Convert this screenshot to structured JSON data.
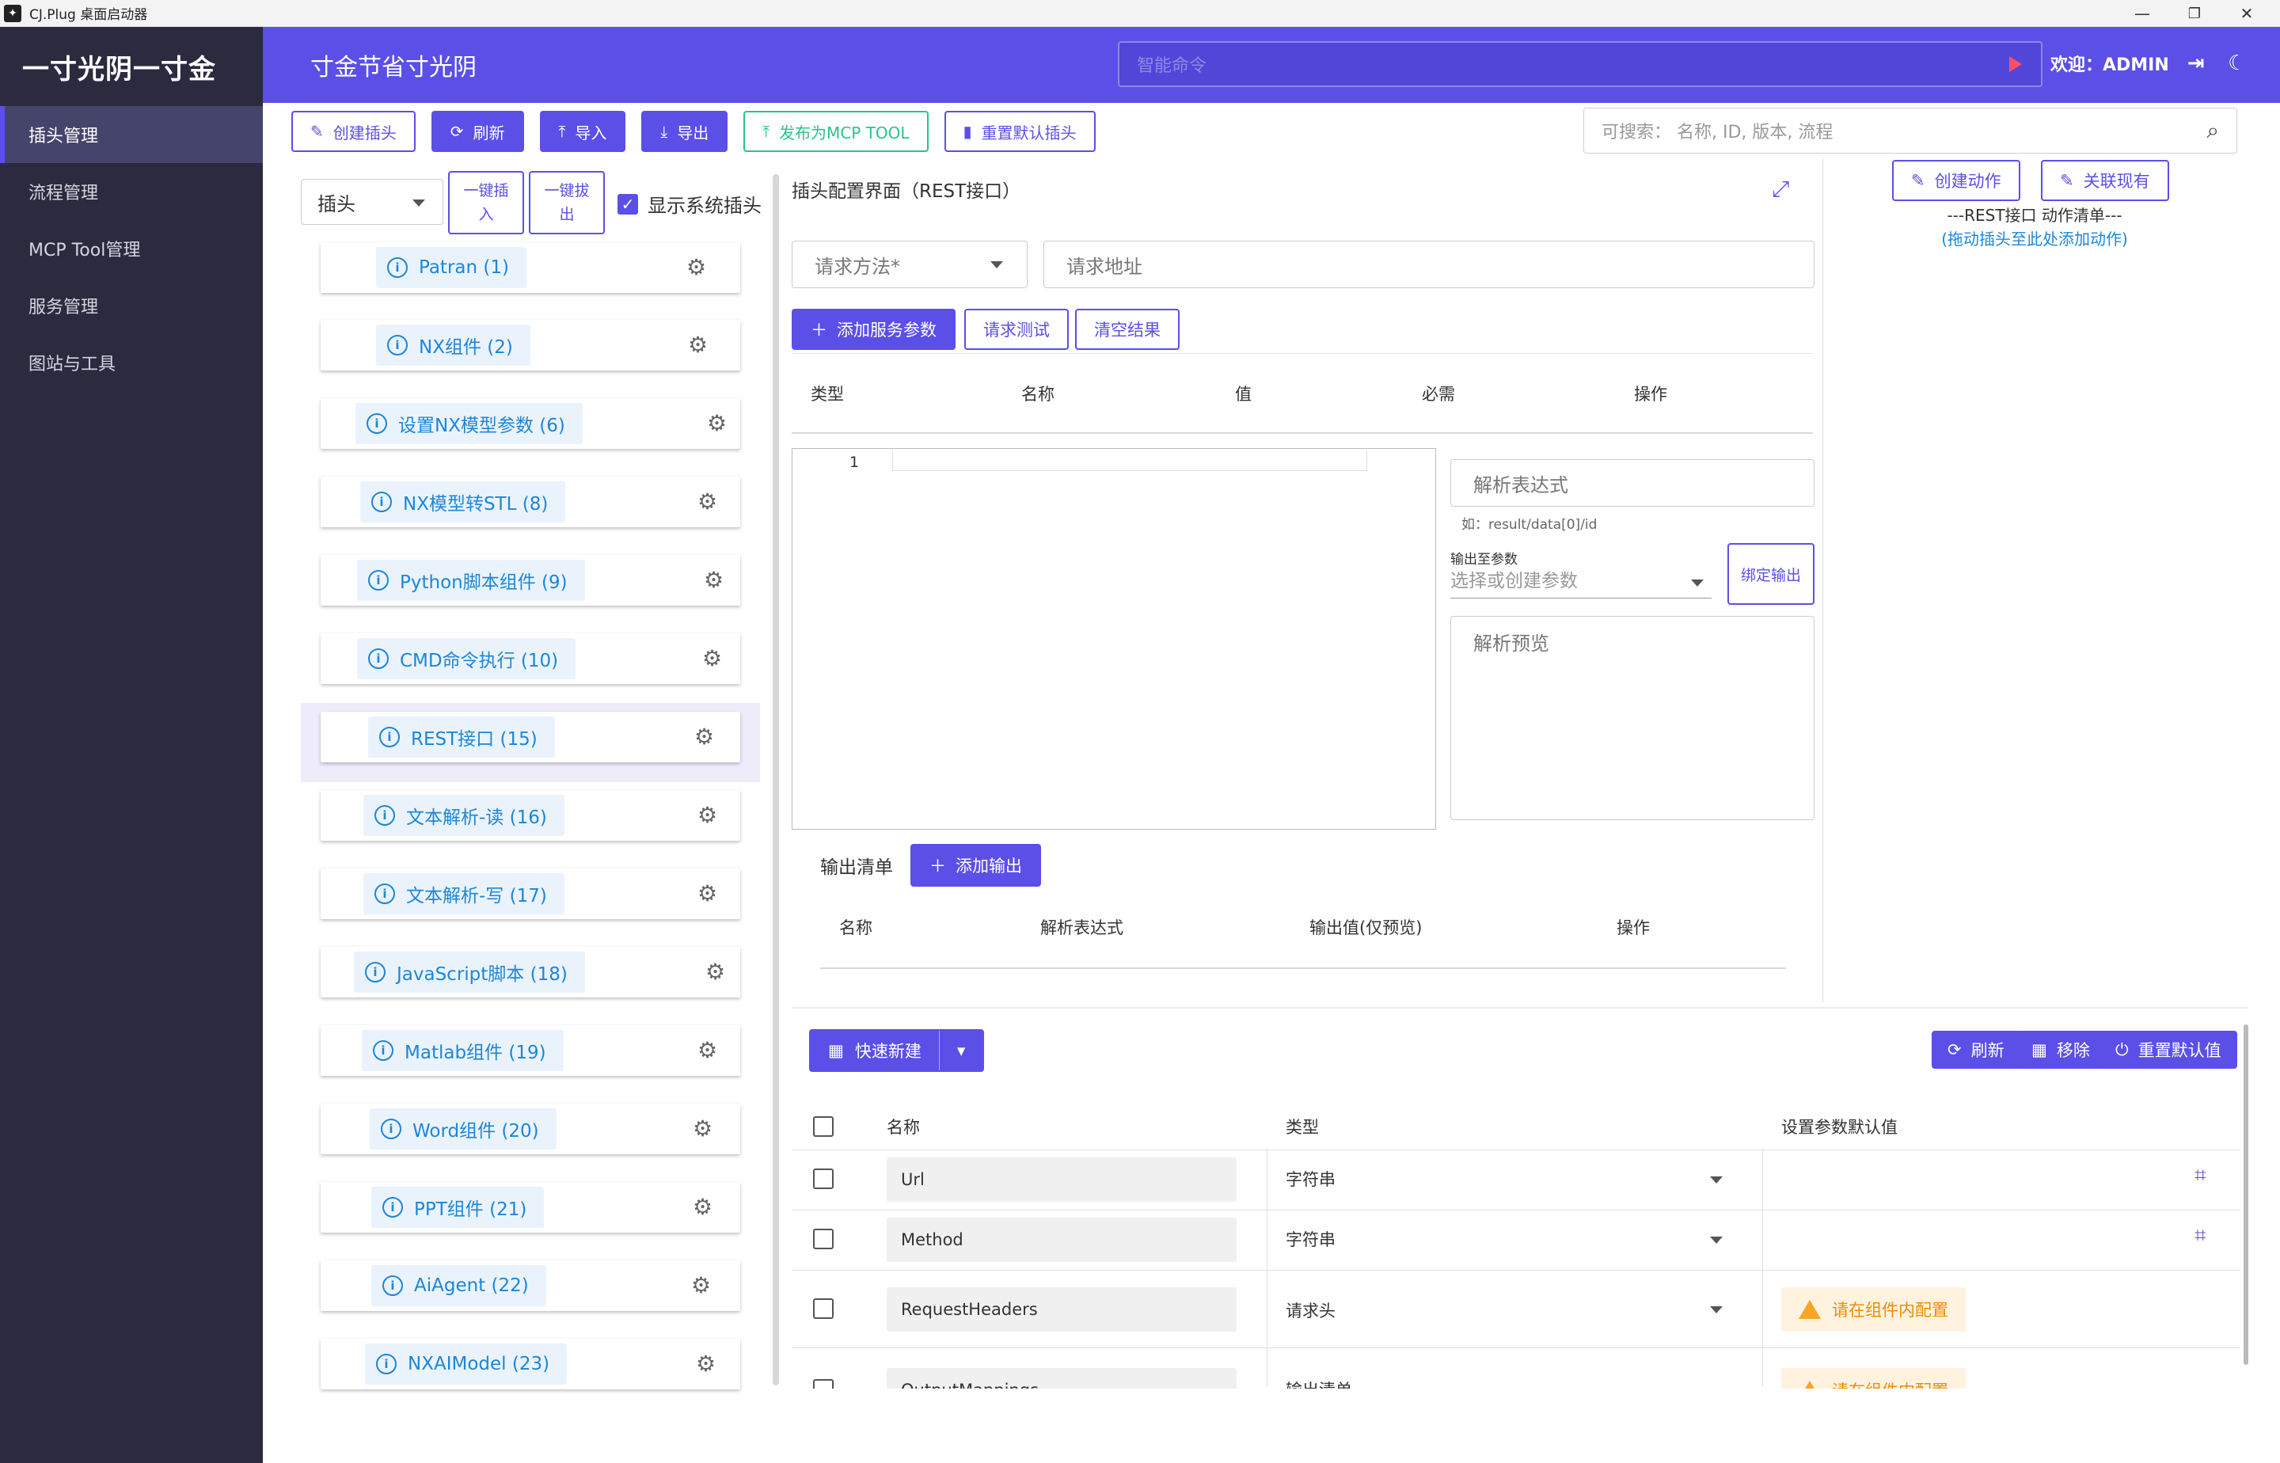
{
  "window": {
    "title": "CJ.Plug 桌面启动器",
    "minimize": "—",
    "maximize": "❐",
    "close": "✕"
  },
  "sidebar": {
    "brand": "一寸光阴一寸金",
    "items": [
      {
        "label": "插头管理",
        "active": true
      },
      {
        "label": "流程管理"
      },
      {
        "label": "MCP Tool管理"
      },
      {
        "label": "服务管理"
      },
      {
        "label": "图站与工具"
      }
    ]
  },
  "header": {
    "slogan": "寸金节省寸光阴",
    "command_placeholder": "智能命令",
    "welcome": "欢迎：ADMIN"
  },
  "toolbar": {
    "buttons": [
      "创建插头",
      "刷新",
      "导入",
      "导出",
      "发布为MCP TOOL",
      "重置默认插头"
    ],
    "search_placeholder": "可搜索：  名称, ID, 版本, 流程"
  },
  "plug_panel": {
    "type_select": "插头",
    "insert_all": "一键插入",
    "unplug_all": "一键拔出",
    "show_system": "显示系统插头",
    "plugs": [
      "Patran (1)",
      "NX组件 (2)",
      "设置NX模型参数 (6)",
      "NX模型转STL (8)",
      "Python脚本组件 (9)",
      "CMD命令执行 (10)",
      "REST接口 (15)",
      "文本解析-读 (16)",
      "文本解析-写 (17)",
      "JavaScript脚本 (18)",
      "Matlab组件 (19)",
      "Word组件 (20)",
      "PPT组件 (21)",
      "AiAgent (22)",
      "NXAIModel (23)"
    ],
    "selected_index": 6
  },
  "config": {
    "title": "插头配置界面（REST接口）",
    "method_placeholder": "请求方法*",
    "url_placeholder": "请求地址",
    "add_param": "添加服务参数",
    "test": "请求测试",
    "clear": "清空结果",
    "param_headers": [
      "类型",
      "名称",
      "值",
      "必需",
      "操作"
    ],
    "editor_line": "1",
    "parse_placeholder": "解析表达式",
    "parse_hint": "如：result/data[0]/id",
    "output_label": "输出至参数",
    "output_placeholder": "选择或创建参数",
    "bind_output": "绑定输出",
    "preview_placeholder": "解析预览",
    "output_list": "输出清单",
    "add_output": "添加输出",
    "output_headers": [
      "名称",
      "解析表达式",
      "输出值(仅预览)",
      "操作"
    ]
  },
  "actions": {
    "create": "创建动作",
    "link": "关联现有",
    "list_title": "---REST接口 动作清单---",
    "hint": "(拖动插头至此处添加动作)"
  },
  "params": {
    "quick_new": "快速新建",
    "refresh": "刷新",
    "remove": "移除",
    "reset": "重置默认值",
    "headers": [
      "名称",
      "类型",
      "设置参数默认值"
    ],
    "rows": [
      {
        "name": "Url",
        "type": "字符串",
        "default": ""
      },
      {
        "name": "Method",
        "type": "字符串",
        "default": ""
      },
      {
        "name": "RequestHeaders",
        "type": "请求头",
        "default": "请在组件内配置"
      },
      {
        "name": "OutputMappings",
        "type": "输出清单",
        "default": "请在组件内配置"
      }
    ]
  },
  "colors": {
    "primary": "#5b4fe8",
    "sidebar": "#2b2a3f",
    "link": "#1d86d9",
    "warning": "#f08c00",
    "success": "#29c48a"
  }
}
